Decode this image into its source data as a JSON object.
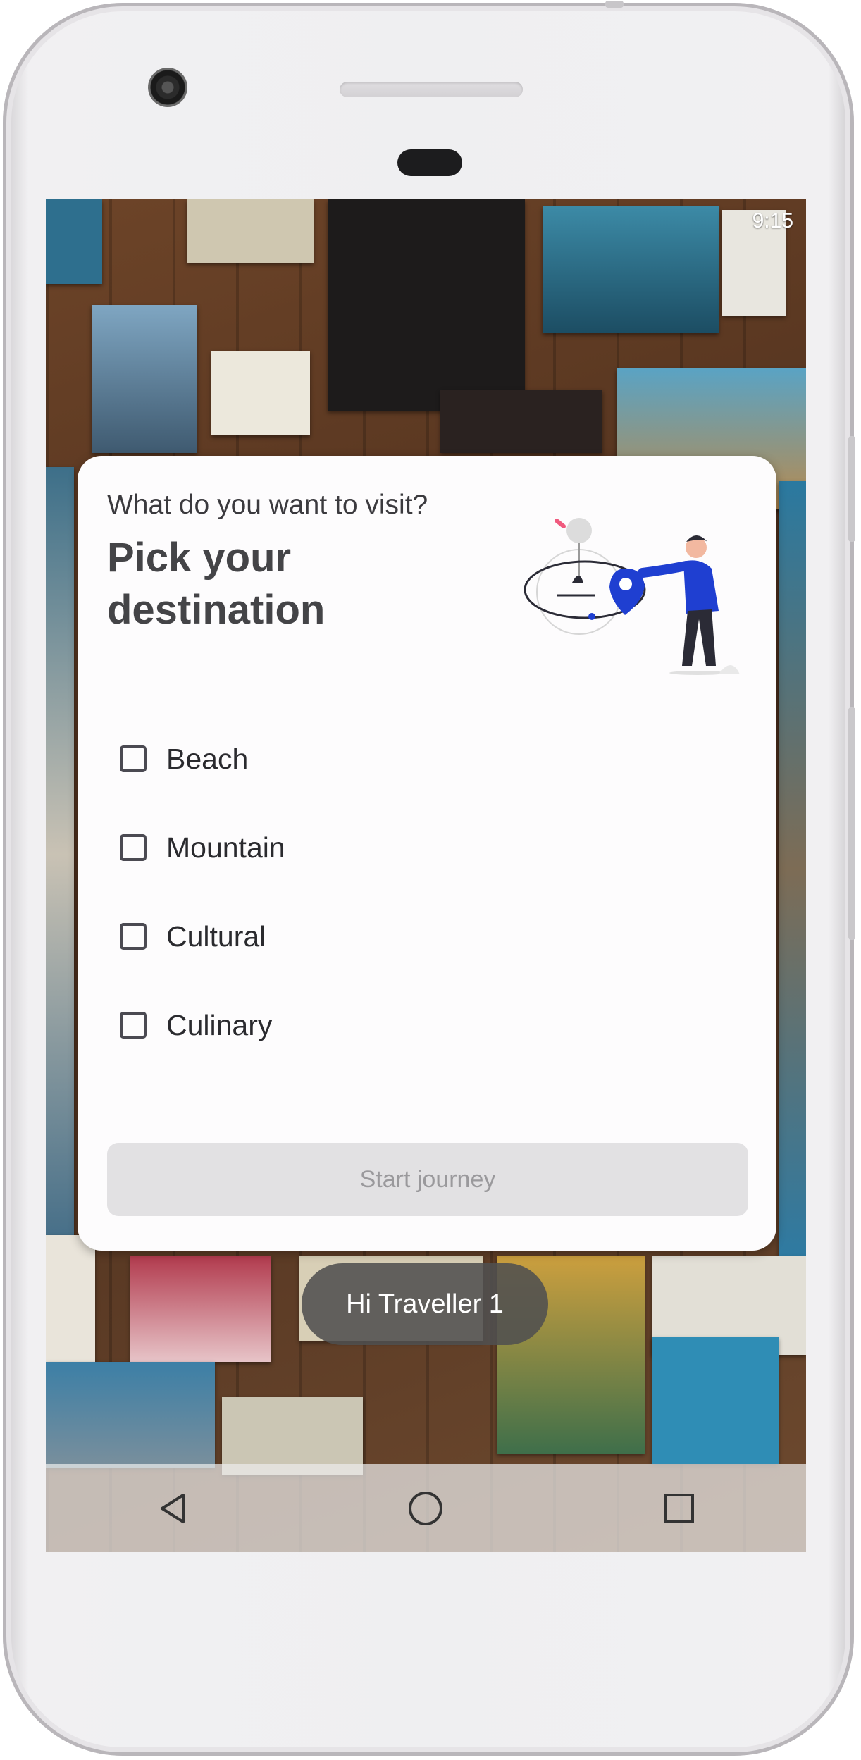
{
  "status_bar": {
    "time": "9:15"
  },
  "card": {
    "subtitle": "What do you want to visit?",
    "title": "Pick your destination",
    "options": [
      {
        "label": "Beach",
        "checked": false
      },
      {
        "label": "Mountain",
        "checked": false
      },
      {
        "label": "Cultural",
        "checked": false
      },
      {
        "label": "Culinary",
        "checked": false
      }
    ],
    "start_button_label": "Start journey",
    "start_button_enabled": false
  },
  "toast": {
    "text": "Hi Traveller 1"
  },
  "nav": {
    "back_icon": "back-triangle-icon",
    "home_icon": "home-circle-icon",
    "recents_icon": "recents-square-icon"
  },
  "colors": {
    "accent": "#1f3fd1",
    "card_bg": "#fdfcfd",
    "disabled_button": "#e2e1e3"
  }
}
